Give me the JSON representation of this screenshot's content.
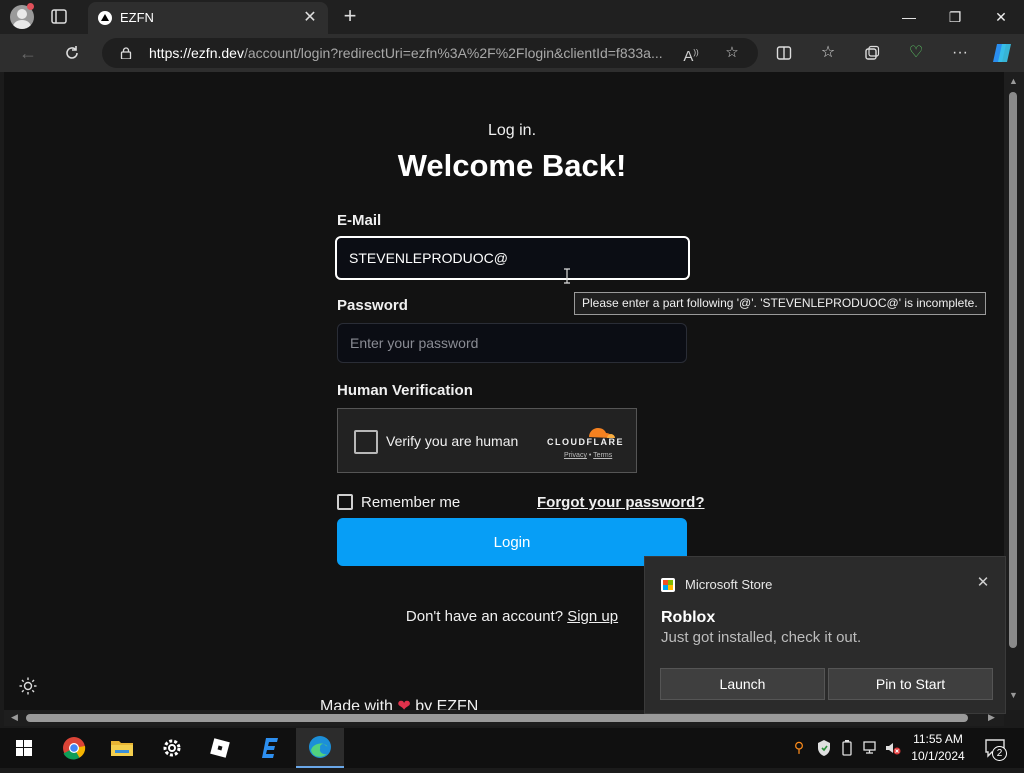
{
  "browser": {
    "tab_title": "EZFN",
    "url_domain": "https://ezfn.dev",
    "url_path": "/account/login?redirectUri=ezfn%3A%2F%2Flogin&clientId=f833a...",
    "window_controls": {
      "minimize": "—",
      "maximize": "❐",
      "close": "✕"
    }
  },
  "login": {
    "subtitle": "Log in.",
    "title": "Welcome Back!",
    "email_label": "E-Mail",
    "email_value": "STEVENLEPRODUOC@",
    "validation_tooltip": "Please enter a part following '@'. 'STEVENLEPRODUOC@' is incomplete.",
    "password_label": "Password",
    "password_placeholder": "Enter your password",
    "verification_label": "Human Verification",
    "verify_text": "Verify you are human",
    "cloudflare_name": "CLOUDFLARE",
    "cloudflare_privacy": "Privacy",
    "cloudflare_sep": " • ",
    "cloudflare_terms": "Terms",
    "remember_label": "Remember me",
    "forgot_link": "Forgot your password?",
    "login_button": "Login",
    "signup_prompt": "Don't have an account? ",
    "signup_link": "Sign up",
    "footer_prefix": "Made with ",
    "footer_suffix": " by EZFN",
    "heart": "❤"
  },
  "toast": {
    "app_name": "Microsoft Store",
    "title": "Roblox",
    "body": "Just got installed, check it out.",
    "launch_button": "Launch",
    "pin_button": "Pin to Start"
  },
  "taskbar": {
    "time": "11:55 AM",
    "date": "10/1/2024",
    "notification_count": "2"
  },
  "colors": {
    "accent_button": "#079ef6",
    "page_background": "#121212",
    "cloudflare_orange": "#f48120"
  }
}
